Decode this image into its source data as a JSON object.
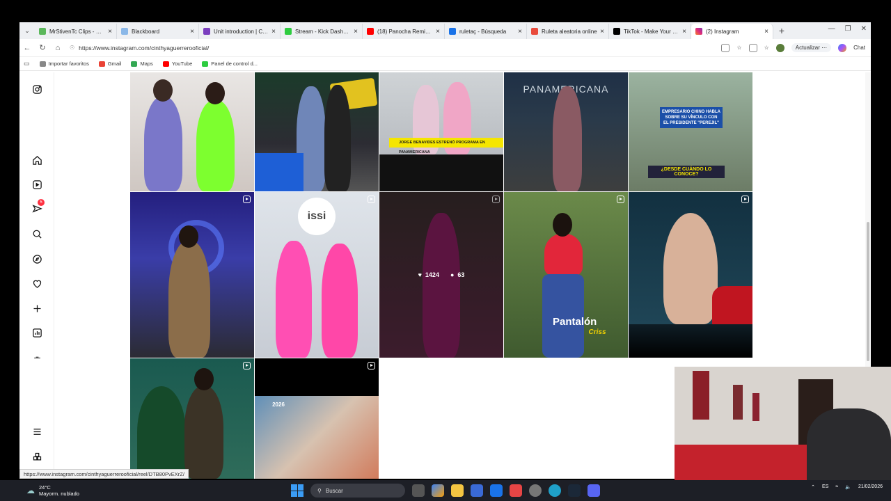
{
  "browser": {
    "tabs": [
      {
        "title": "MrStivenTc Clips - Watch",
        "color": "#5cb85c"
      },
      {
        "title": "Blackboard",
        "color": "#8bb8e8"
      },
      {
        "title": "Unit introduction | Cam",
        "color": "#7b3fbf"
      },
      {
        "title": "Stream - Kick Dashboard",
        "color": "#2ecc40"
      },
      {
        "title": "(18) Panocha Remix - Fa",
        "color": "#ff0000"
      },
      {
        "title": "ruletaç - Búsqueda",
        "color": "#1a73e8"
      },
      {
        "title": "Ruleta aleatoria online",
        "color": "#e94b3c"
      },
      {
        "title": "TikTok - Make Your Day",
        "color": "#000000"
      },
      {
        "title": "(2) Instagram",
        "color": "#d6249f"
      }
    ],
    "new_tab": "+",
    "url": "https://www.instagram.com/cinthyaguerrerooficial/",
    "update_label": "Actualizar",
    "chat_label": "Chat",
    "bookmarks": [
      {
        "label": "Importar favoritos",
        "color": "#888888"
      },
      {
        "label": "Gmail",
        "color": "#ea4335"
      },
      {
        "label": "Maps",
        "color": "#34a853"
      },
      {
        "label": "YouTube",
        "color": "#ff0000"
      },
      {
        "label": "Panel de control d...",
        "color": "#2ecc40"
      }
    ],
    "status_url": "https://www.instagram.com/cinthyaguerrerooficial/reel/DTB80PvEXrZ/"
  },
  "instagram": {
    "sidebar_icons": [
      "instagram-icon",
      "home-icon",
      "reels-icon",
      "messages-icon",
      "search-icon",
      "explore-icon",
      "notifications-icon",
      "create-icon",
      "dashboard-icon",
      "threads-icon",
      "menu-icon",
      "meta-icon"
    ],
    "messages_badge": "5",
    "posts": [
      {
        "caption": ""
      },
      {
        "caption": ""
      },
      {
        "caption": "JORGE BENAVIDES ESTRENÓ PROGRAMA EN PANAMERICANA"
      },
      {
        "caption": "PANAMERICANA"
      },
      {
        "caption": "EMPRESARIO CHINO HABLA SOBRE SU VÍNCULO CON EL PRESIDENTE \"PEREJIL\"",
        "subcaption": "¿DESDE CUÁNDO LO CONOCE?"
      },
      {
        "caption": ""
      },
      {
        "caption": "issi"
      },
      {
        "caption": "",
        "likes": "1424",
        "comments": "63"
      },
      {
        "caption": "Pantalón",
        "subcaption": "Criss"
      },
      {
        "caption": ""
      },
      {
        "caption": ""
      },
      {
        "caption": "2026"
      }
    ]
  },
  "taskbar": {
    "temperature": "24°C",
    "weather": "Mayorm. nublado",
    "search_placeholder": "Buscar",
    "language": "ES",
    "date": "21/02/2026"
  }
}
